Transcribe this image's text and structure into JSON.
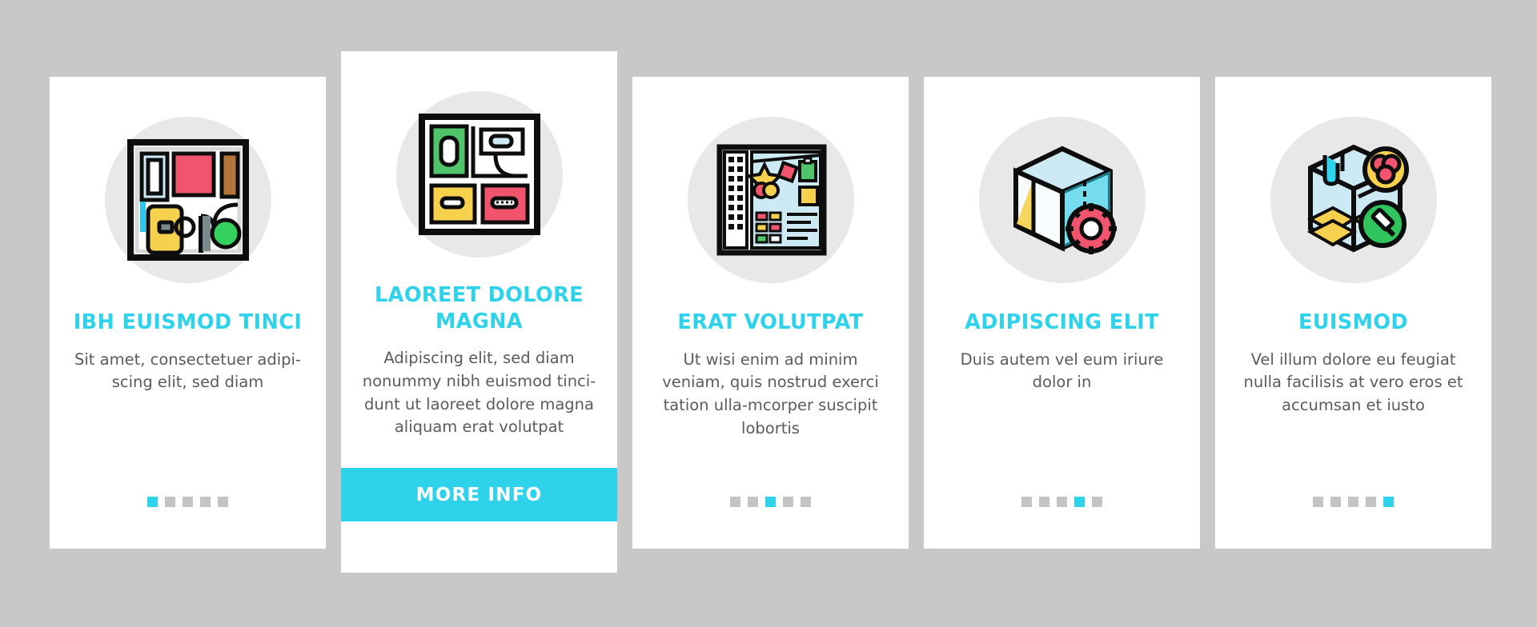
{
  "background_color": "#c8c8c8",
  "accent_color": "#2ed2ea",
  "card_background": "#ffffff",
  "icon_disc_color": "#e8e8e8",
  "body_text_color": "#5b5b5b",
  "dot_inactive_color": "#c4c4c4",
  "cards": [
    {
      "icon_name": "floor-plan-icon",
      "title": "IBH EUISMOD TINCI",
      "body": "Sit amet, consectetuer adipi-scing elit, sed diam",
      "dots": {
        "total": 5,
        "active_index": 0
      },
      "featured": false
    },
    {
      "icon_name": "room-layout-icon",
      "title": "LAOREET DOLORE MAGNA",
      "body": "Adipiscing elit, sed diam nonummy nibh euismod tinci-dunt ut laoreet dolore magna aliquam erat volutpat",
      "button_label": "MORE INFO",
      "featured": true
    },
    {
      "icon_name": "design-board-icon",
      "title": "ERAT VOLUTPAT",
      "body": "Ut wisi enim ad minim veniam, quis nostrud exerci tation ulla-mcorper suscipit lobortis",
      "dots": {
        "total": 5,
        "active_index": 2
      },
      "featured": false
    },
    {
      "icon_name": "room-settings-icon",
      "title": "ADIPISCING ELIT",
      "body": "Duis autem vel eum iriure dolor in",
      "dots": {
        "total": 5,
        "active_index": 3
      },
      "featured": false
    },
    {
      "icon_name": "interior-finish-icon",
      "title": "EUISMOD",
      "body": "Vel illum dolore eu feugiat nulla facilisis at vero eros et accumsan et iusto",
      "dots": {
        "total": 5,
        "active_index": 4
      },
      "featured": false
    }
  ]
}
